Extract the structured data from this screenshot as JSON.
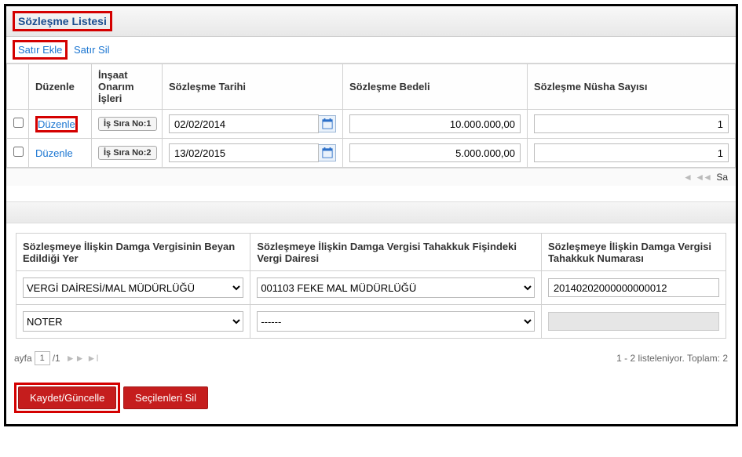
{
  "panel": {
    "title": "Sözleşme Listesi"
  },
  "toolbar": {
    "add_row": "Satır Ekle",
    "del_row": "Satır Sil"
  },
  "grid": {
    "headers": {
      "edit": "Düzenle",
      "job": "İnşaat Onarım İşleri",
      "date": "Sözleşme Tarihi",
      "amount": "Sözleşme Bedeli",
      "copies": "Sözleşme Nüsha Sayısı"
    },
    "rows": [
      {
        "edit": "Düzenle",
        "job": "İş Sıra No:1",
        "date": "02/02/2014",
        "amount": "10.000.000,00",
        "copies": "1"
      },
      {
        "edit": "Düzenle",
        "job": "İş Sıra No:2",
        "date": "13/02/2015",
        "amount": "5.000.000,00",
        "copies": "1"
      }
    ],
    "pager_suffix": "Sa"
  },
  "grid2": {
    "headers": {
      "a": "Sözleşmeye İlişkin Damga Vergisinin Beyan Edildiği Yer",
      "b": "Sözleşmeye İlişkin Damga Vergisi Tahakkuk Fişindeki Vergi Dairesi",
      "c": "Sözleşmeye İlişkin Damga Vergisi Tahakkuk Numarası"
    },
    "rows": [
      {
        "a": "VERGİ DAİRESİ/MAL MÜDÜRLÜĞÜ",
        "b": "001103 FEKE MAL MÜDÜRLÜĞÜ",
        "c": "20140202000000000012"
      },
      {
        "a": "NOTER",
        "b": "------",
        "c_disabled": true
      }
    ]
  },
  "footer": {
    "page_label_prefix": "ayfa",
    "page_current": "1",
    "page_total": "/1",
    "listing": "1 - 2 listeleniyor. Toplam: 2"
  },
  "actions": {
    "save": "Kaydet/Güncelle",
    "delete_selected": "Seçilenleri Sil"
  }
}
